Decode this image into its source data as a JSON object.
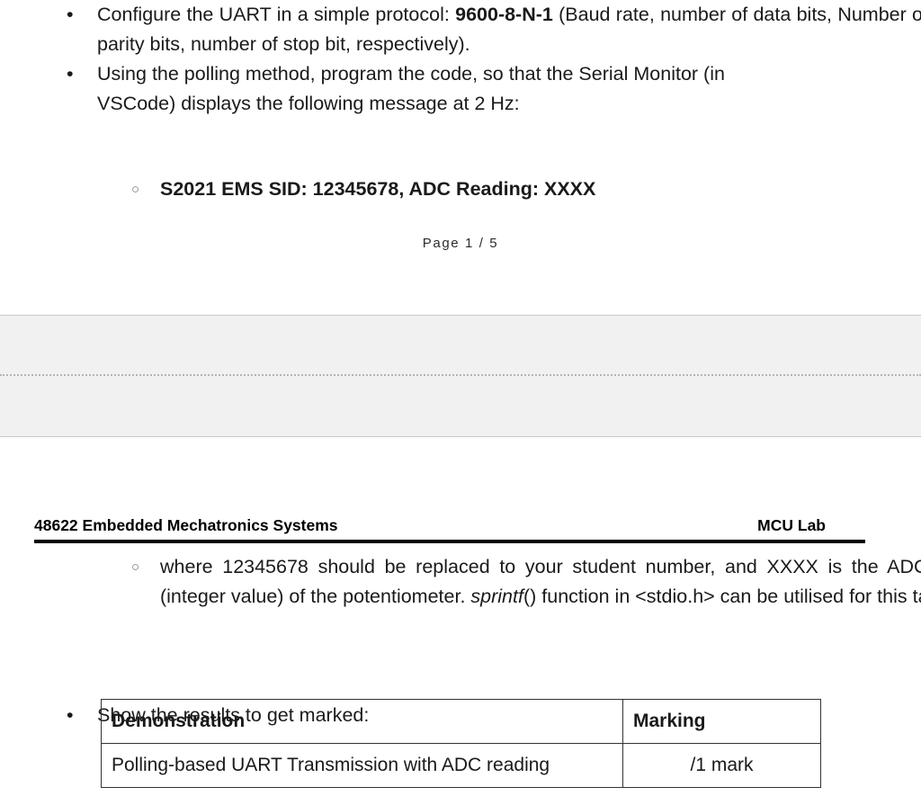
{
  "page_one": {
    "bullets": [
      {
        "marker": "disc",
        "segments_text": "Configure the UART in a simple protocol: 9600-8-N-1 (Baud rate, number of data bits, Number of parity bits, number of stop bit, respectively).",
        "part_a": "Configure the UART in a simple protocol: ",
        "part_b_bold": "9600-8-N-1",
        "part_c": " (Baud rate, number of data bits, Number of parity bits, number of stop bit, respectively)."
      },
      {
        "marker": "disc",
        "segments_text": "Using the polling method, program the code, so that the Serial Monitor (in VSCode) displays the following message at 2 Hz:",
        "line_1": "Using the polling method, program the code, so that the Serial Monitor (in",
        "line_2": "VSCode) displays the following message at 2 Hz:"
      }
    ],
    "sub_bullet": {
      "marker": "circle",
      "text": "S2021 EMS SID: 12345678, ADC Reading: XXXX"
    },
    "page_number": "Page 1 / 5"
  },
  "page_two": {
    "header": {
      "left": "48622 Embedded Mechatronics Systems",
      "right": "MCU Lab"
    },
    "sub_bullet": {
      "marker": "circle",
      "part_a": "where 12345678 should be replaced to your student number, and XXXX is the ADC output (integer value) of the potentiometer. ",
      "part_b_italic": "sprintf",
      "part_c": "() function in <stdio.h> can be utilised for this task."
    },
    "bullet": {
      "marker": "disc",
      "text": "Show the results to get marked:"
    },
    "table": {
      "headers": [
        "Demonstration",
        "Marking"
      ],
      "rows": [
        [
          "Polling-based UART Transmission with ADC reading",
          "/1 mark"
        ]
      ]
    }
  },
  "colors": {
    "page_background": "#ffffff",
    "gap_background": "#f1f1f1",
    "gap_border": "#c8c8c8",
    "text": "#1a1a1a",
    "rule": "#000000",
    "table_border": "#333333"
  }
}
